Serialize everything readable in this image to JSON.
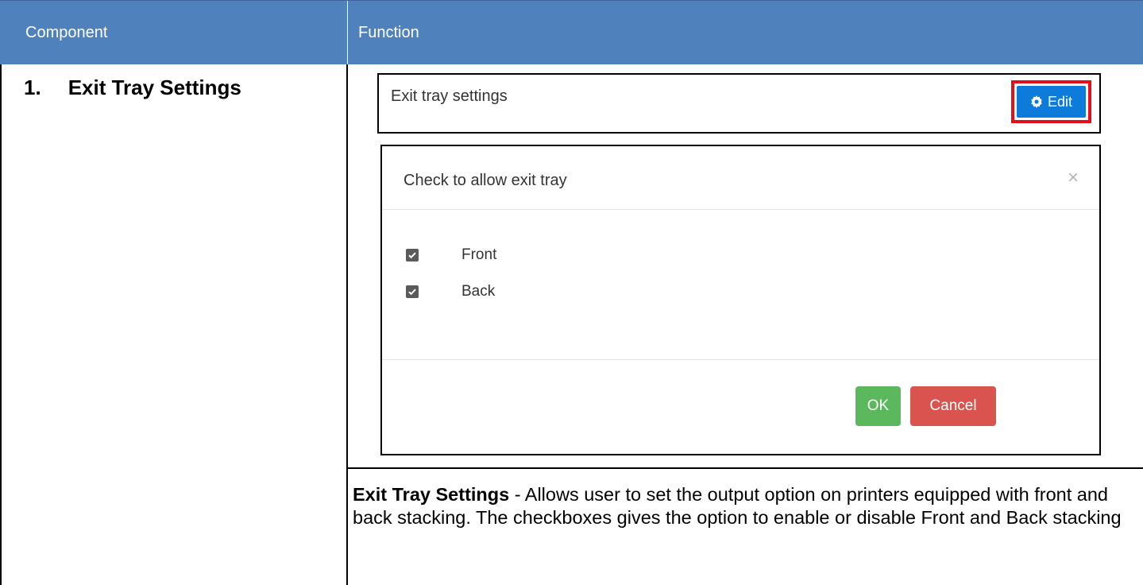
{
  "header": {
    "component_label": "Component",
    "function_label": "Function"
  },
  "component": {
    "number": "1.",
    "name": "Exit Tray Settings"
  },
  "settings_box": {
    "title": "Exit tray settings",
    "edit_label": "Edit",
    "edit_icon": "gear-icon",
    "highlight_color": "#e3101b",
    "button_color": "#0d7bd9"
  },
  "modal": {
    "title": "Check to allow exit tray",
    "close_symbol": "×",
    "options": [
      {
        "label": "Front",
        "checked": true
      },
      {
        "label": "Back",
        "checked": true
      }
    ],
    "ok_label": "OK",
    "cancel_label": "Cancel",
    "ok_color": "#5cb85c",
    "cancel_color": "#d9534f"
  },
  "description": {
    "term": "Exit Tray Settings",
    "text": " - Allows user to set the output option on printers equipped with front and back stacking. The checkboxes gives the option to enable or disable Front and Back stacking"
  },
  "colors": {
    "header_bg": "#4f81bd"
  }
}
